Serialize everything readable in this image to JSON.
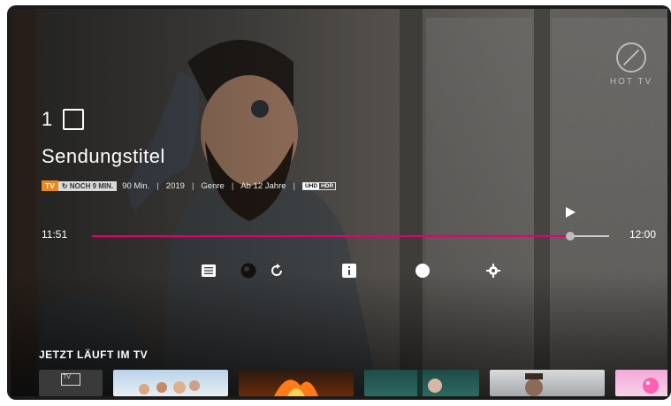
{
  "channel": {
    "number": "1"
  },
  "program": {
    "title": "Sendungstitel",
    "badge_tv": "TV",
    "remaining_prefix": "NOCH",
    "remaining_value": "9 MIN.",
    "duration": "90 Min.",
    "year": "2019",
    "genre": "Genre",
    "age": "Ab 12 Jahre",
    "format_uhd": "UHD",
    "format_hdr": "HDR",
    "separator": "|"
  },
  "brand": {
    "logo_text": "HOT TV"
  },
  "playback": {
    "start_time": "11:51",
    "end_time": "12:00",
    "progress_fraction": 0.925,
    "accent_color": "#e20074"
  },
  "controls": [
    {
      "name": "menu-icon"
    },
    {
      "name": "record-dot-icon"
    },
    {
      "name": "restart-icon"
    },
    {
      "name": "info-icon"
    },
    {
      "name": "circle-icon"
    },
    {
      "name": "gear-icon"
    }
  ],
  "rail": {
    "title": "JETZT LÄUFT IM TV",
    "items": [
      {
        "name": "epg-guide-tile",
        "icon": "tv-guide-icon",
        "label": "TV"
      },
      {
        "name": "thumb-family"
      },
      {
        "name": "thumb-fire"
      },
      {
        "name": "thumb-woman-forest"
      },
      {
        "name": "thumb-man-profile"
      },
      {
        "name": "thumb-cartoon"
      }
    ]
  }
}
